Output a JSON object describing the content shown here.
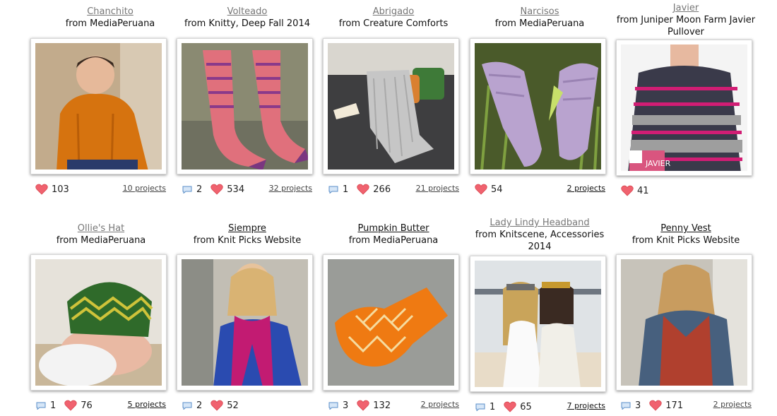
{
  "patterns": [
    {
      "title": "Chanchito",
      "source": "from MediaPeruana",
      "comments": "",
      "hearts": "103",
      "projects": "10 projects",
      "image": "toddler in orange cardigan"
    },
    {
      "title": "Volteado",
      "source": "from Knitty, Deep Fall 2014",
      "comments": "2",
      "hearts": "534",
      "projects": "32 projects",
      "image": "pink and purple zigzag socks"
    },
    {
      "title": "Abrigado",
      "source": "from Creature Comforts",
      "comments": "1",
      "hearts": "266",
      "projects": "21 projects",
      "image": "grey blanket on sofa"
    },
    {
      "title": "Narcisos",
      "source": "from MediaPeruana",
      "comments": "",
      "hearts": "54",
      "projects": "2 projects",
      "image": "lilac lace fingerless mitts"
    },
    {
      "title": "Javier",
      "source": "from Juniper Moon Farm Javier Pullover",
      "comments": "",
      "hearts": "41",
      "projects": "",
      "image": "striped grey and pink pullover",
      "badge": "JAVIER"
    },
    {
      "title": "Ollie's Hat",
      "source": "from MediaPeruana",
      "comments": "1",
      "hearts": "76",
      "projects": "5 projects",
      "image": "baby in green zigzag hat"
    },
    {
      "title": "Siempre",
      "source": "from Knit Picks Website",
      "comments": "2",
      "hearts": "52",
      "projects": "",
      "image": "woman with magenta cowl"
    },
    {
      "title": "Pumpkin Butter",
      "source": "from MediaPeruana",
      "comments": "3",
      "hearts": "132",
      "projects": "2 projects",
      "image": "orange diamond-pattern sock"
    },
    {
      "title": "Lady Lindy Headband",
      "source": "from Knitscene, Accessories 2014",
      "comments": "1",
      "hearts": "65",
      "projects": "7 projects",
      "image": "two women wearing headbands"
    },
    {
      "title": "Penny Vest",
      "source": "from Knit Picks Website",
      "comments": "3",
      "hearts": "171",
      "projects": "2 projects",
      "image": "woman in rust knit vest"
    }
  ],
  "colors": {
    "heart": "#f0626f",
    "comment": "#5b8fc8",
    "visited_link": "#777777",
    "link": "#111111"
  }
}
